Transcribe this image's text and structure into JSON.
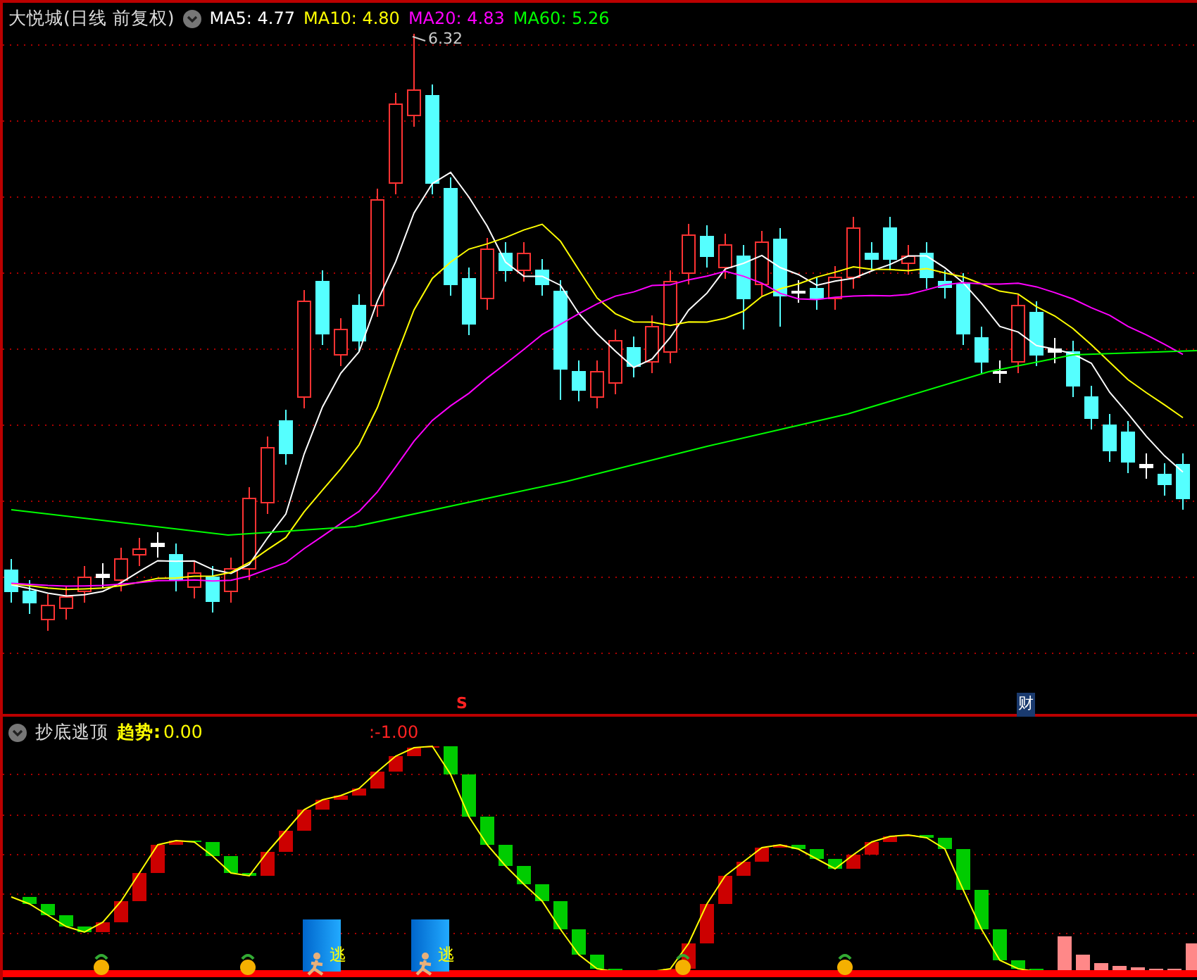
{
  "main_panel": {
    "title": "大悦城(日线 前复权)",
    "indicators": [
      {
        "label": "MA5:",
        "value": "4.77",
        "color": "#ffffff"
      },
      {
        "label": "MA10:",
        "value": "4.80",
        "color": "#ffff00"
      },
      {
        "label": "MA20:",
        "value": "4.83",
        "color": "#ff00ff"
      },
      {
        "label": "MA60:",
        "value": "5.26",
        "color": "#00ff00"
      }
    ],
    "high_label": "6.32",
    "markers": [
      {
        "kind": "signal",
        "text": "S"
      },
      {
        "kind": "finance",
        "text": "财"
      }
    ]
  },
  "indicator_panel": {
    "title": "抄底逃顶",
    "field": {
      "label": "趋势:",
      "value": "0.00"
    },
    "reading": ":-1.00",
    "signals": [
      {
        "text": "逃"
      },
      {
        "text": "逃"
      }
    ]
  }
}
